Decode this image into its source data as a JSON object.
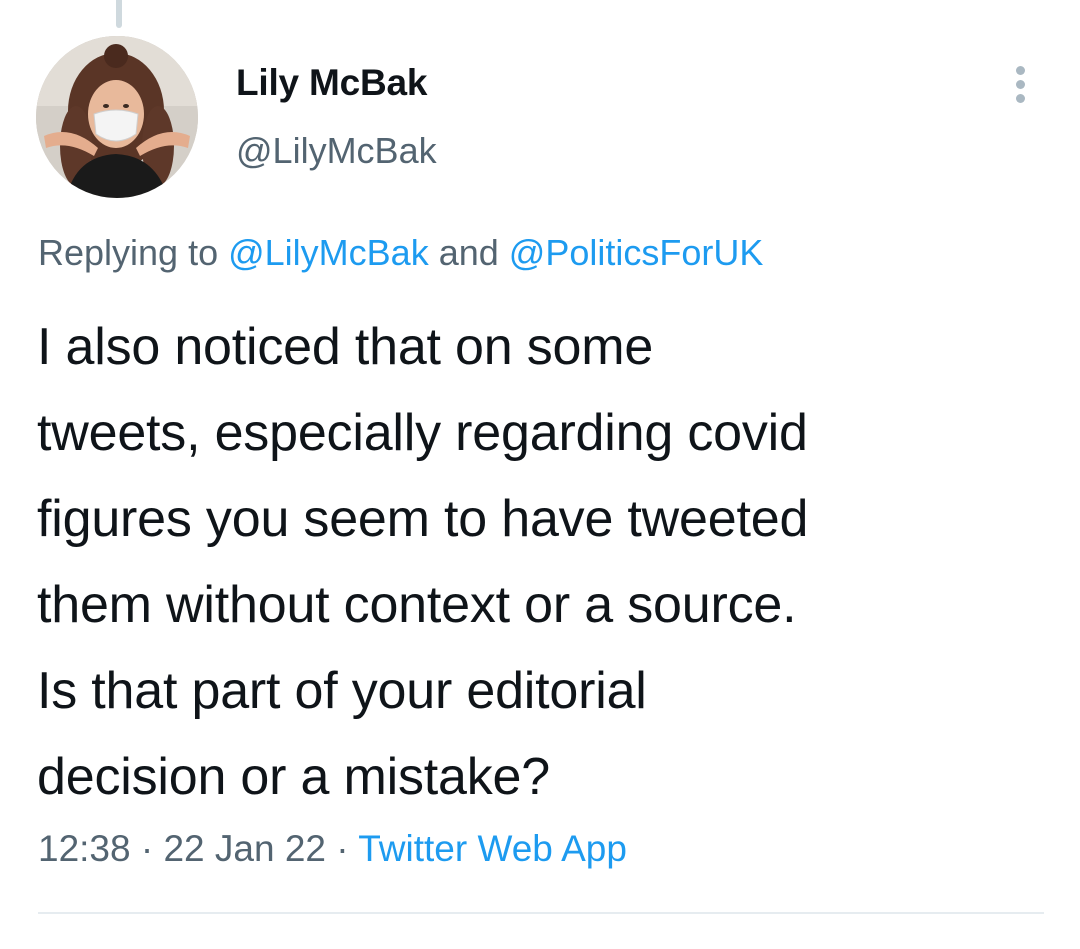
{
  "author": {
    "display_name": "Lily McBak",
    "handle": "@LilyMcBak",
    "avatar_icon": "profile-photo-masked-woman"
  },
  "more_icon": "more-vertical-icon",
  "reply_context": {
    "prefix": "Replying to ",
    "mention_1": "@LilyMcBak",
    "joiner": " and ",
    "mention_2": "@PoliticsForUK"
  },
  "tweet": {
    "lines": [
      "I also noticed that on some",
      "tweets, especially regarding covid",
      "figures you seem to have tweeted",
      "them without context or a source.",
      "Is that part of your editorial",
      "decision or a mistake?"
    ]
  },
  "meta": {
    "time": "12:38",
    "separator": " · ",
    "date": "22 Jan 22",
    "source": "Twitter Web App"
  },
  "colors": {
    "link": "#1d9bf0",
    "secondary_text": "#536471",
    "primary_text": "#0f1419",
    "divider": "#e6ecf0"
  }
}
